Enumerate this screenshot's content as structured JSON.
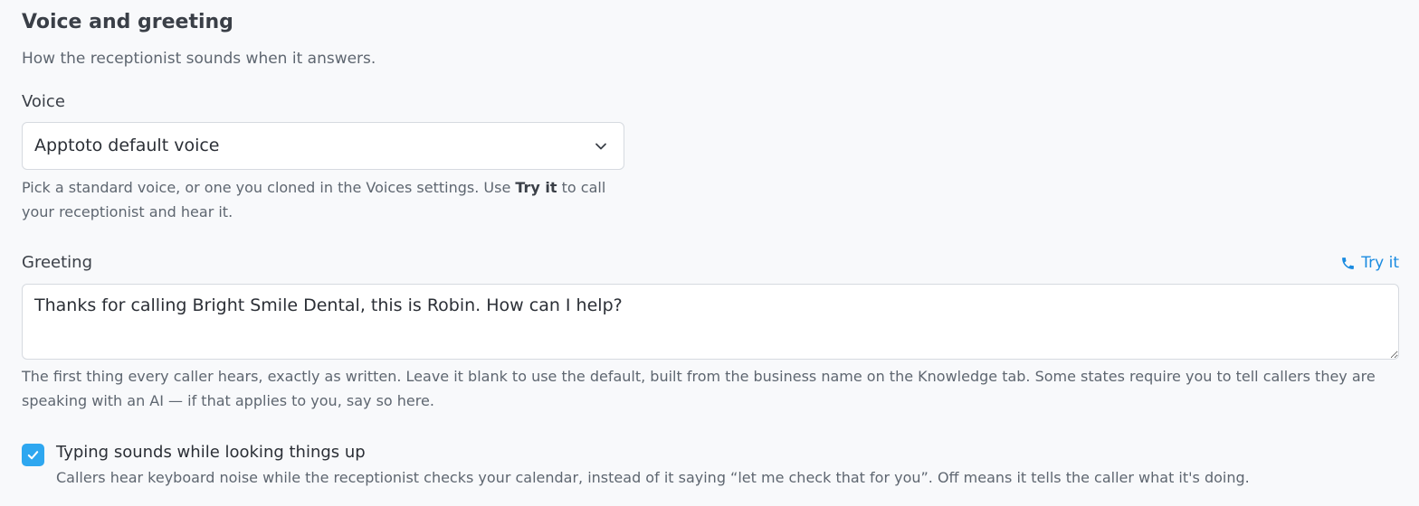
{
  "section": {
    "title": "Voice and greeting",
    "subtitle": "How the receptionist sounds when it answers."
  },
  "voice": {
    "label": "Voice",
    "selected": "Apptoto default voice",
    "help_before": "Pick a standard voice, or one you cloned in the Voices settings. Use ",
    "help_bold": "Try it",
    "help_after": " to call your receptionist and hear it."
  },
  "greeting": {
    "label": "Greeting",
    "try_label": "Try it",
    "value": "Thanks for calling Bright Smile Dental, this is Robin. How can I help?",
    "help": "The first thing every caller hears, exactly as written. Leave it blank to use the default, built from the business name on the Knowledge tab. Some states require you to tell callers they are speaking with an AI — if that applies to you, say so here."
  },
  "typing_sounds": {
    "checked": true,
    "label": "Typing sounds while looking things up",
    "help": "Callers hear keyboard noise while the receptionist checks your calendar, instead of it saying “let me check that for you”. Off means it tells the caller what it's doing."
  },
  "icons": {
    "select_chevron": "chevron-down-icon",
    "try_it": "phone-icon",
    "checkbox": "check-icon"
  },
  "colors": {
    "accent": "#1a8be0",
    "checkbox": "#2ea7f0"
  }
}
